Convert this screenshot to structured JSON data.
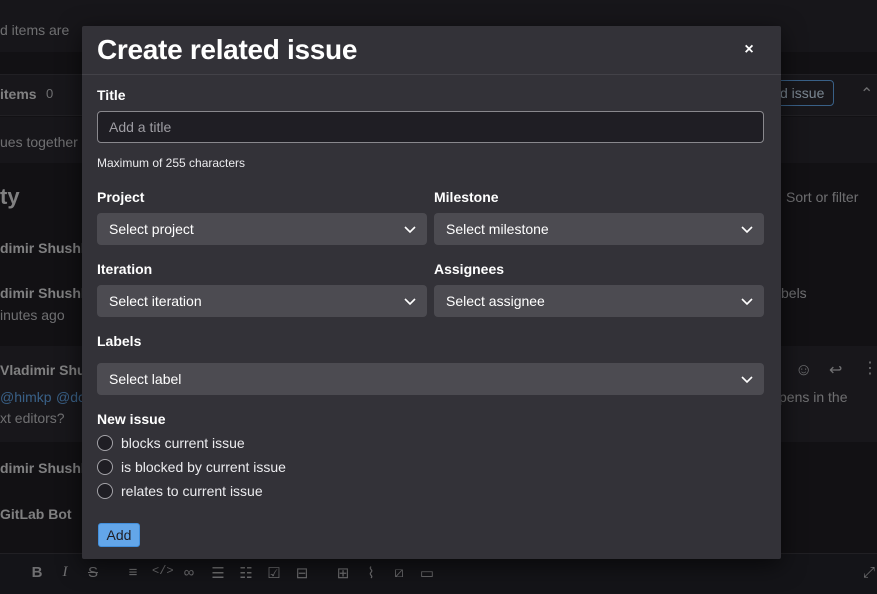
{
  "background": {
    "banner_text": "d items are ",
    "linked_items_label": "items",
    "linked_items_count": "0",
    "add_issue_button": "d issue",
    "hint_text": "ues together",
    "heading_fragment": "ty",
    "sort_filter": "Sort or filter",
    "activity_1_author": "dimir Shushl",
    "activity_2_author": "dimir Shushl",
    "activity_2_time": "inutes ago",
    "activity_2_side": "bels",
    "comment_author": "Vladimir Shus",
    "comment_mention_1": "@himkp",
    "comment_mention_2": "@dc",
    "comment_side": "pens in the",
    "comment_line_2": "xt editors?",
    "activity_3_author": "dimir Shushl",
    "bot_author": "GitLab Bot"
  },
  "modal": {
    "title": "Create related issue",
    "close_label": "×",
    "title_field": {
      "label": "Title",
      "placeholder": "Add a title",
      "value": "",
      "help": "Maximum of 255 characters"
    },
    "project": {
      "label": "Project",
      "selected": "Select project"
    },
    "milestone": {
      "label": "Milestone",
      "selected": "Select milestone"
    },
    "iteration": {
      "label": "Iteration",
      "selected": "Select iteration"
    },
    "assignees": {
      "label": "Assignees",
      "selected": "Select assignee"
    },
    "labels": {
      "label": "Labels",
      "selected": "Select label"
    },
    "new_issue": {
      "label": "New issue",
      "options": [
        "blocks current issue",
        "is blocked by current issue",
        "relates to current issue"
      ]
    },
    "submit_label": "Add"
  },
  "colors": {
    "accent": "#63a6e9",
    "modal_bg": "#333238",
    "dropdown_bg": "#4c4b51"
  }
}
